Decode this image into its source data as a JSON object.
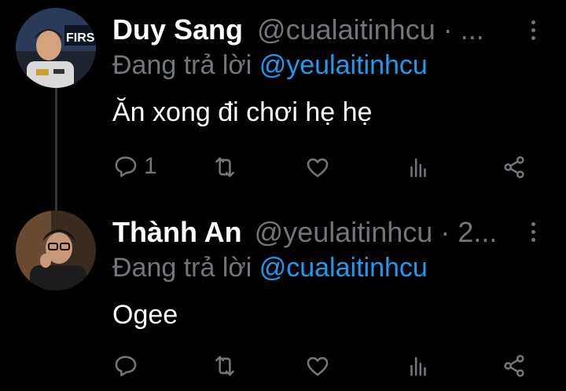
{
  "tweets": [
    {
      "display_name": "Duy Sang",
      "handle": "@cualaitinhcu · ...",
      "replying_prefix": "Đang trả lời",
      "replying_to": "@yeulaitinhcu",
      "text": "Ăn xong đi chơi hẹ hẹ",
      "reply_count": "1",
      "avatar_sign_text": "FIRST"
    },
    {
      "display_name": "Thành An",
      "handle": "@yeulaitinhcu · 2...",
      "replying_prefix": "Đang trả lời",
      "replying_to": "@cualaitinhcu",
      "text": "Ogee",
      "reply_count": ""
    }
  ],
  "colors": {
    "background": "#000000",
    "text": "#e7e9ea",
    "muted": "#71767b",
    "accent": "#1d9bf0",
    "thread_line": "#333639"
  },
  "icons": [
    "reply-icon",
    "retweet-icon",
    "like-icon",
    "views-icon",
    "share-icon",
    "more-icon"
  ]
}
